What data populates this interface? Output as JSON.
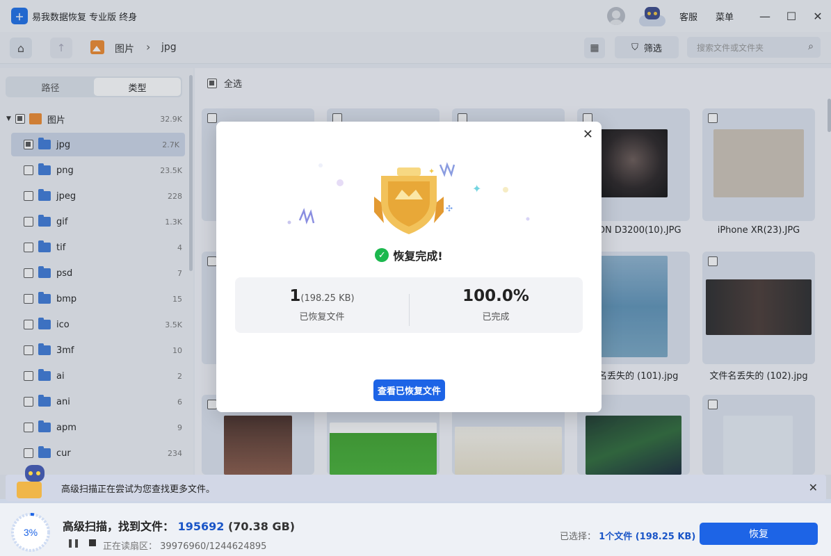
{
  "app": {
    "title": "易我数据恢复 专业版 终身"
  },
  "titlebar": {
    "support_label": "客服",
    "menu_label": "菜单",
    "minimize": "—",
    "maximize": "☐",
    "close": "✕"
  },
  "toolbar": {
    "breadcrumb": [
      "图片",
      "jpg"
    ],
    "filter_label": "筛选",
    "search_placeholder": "搜索文件或文件夹"
  },
  "sidebar": {
    "tabs": [
      {
        "label": "路径",
        "active": false
      },
      {
        "label": "类型",
        "active": true
      }
    ],
    "root": {
      "label": "图片",
      "count": "32.9K"
    },
    "items": [
      {
        "label": "jpg",
        "count": "2.7K",
        "selected": true
      },
      {
        "label": "png",
        "count": "23.5K"
      },
      {
        "label": "jpeg",
        "count": "228"
      },
      {
        "label": "gif",
        "count": "1.3K"
      },
      {
        "label": "tif",
        "count": "4"
      },
      {
        "label": "psd",
        "count": "7"
      },
      {
        "label": "bmp",
        "count": "15"
      },
      {
        "label": "ico",
        "count": "3.5K"
      },
      {
        "label": "3mf",
        "count": "10"
      },
      {
        "label": "ai",
        "count": "2"
      },
      {
        "label": "ani",
        "count": "6"
      },
      {
        "label": "apm",
        "count": "9"
      },
      {
        "label": "cur",
        "count": "234"
      }
    ]
  },
  "main": {
    "select_all_label": "全选",
    "files": [
      {
        "name": "DN D3200(10).JPG"
      },
      {
        "name": "iPhone XR(23).JPG"
      },
      {
        "name": "名丢失的 (101).jpg"
      },
      {
        "name": "文件名丢失的 (102).jpg"
      }
    ]
  },
  "notice": {
    "text": "高级扫描正在尝试为您查找更多文件。"
  },
  "bottom": {
    "scan_prefix": "高级扫描，找到文件：",
    "found_count": "195692",
    "found_size": "(70.38 GB)",
    "progress_label": "3%",
    "progress": 0.03,
    "reading_label": "正在读扇区：",
    "reading_value": "39976960/1244624895",
    "selected_label": "已选择：",
    "selected_value": "1个文件 (198.25 KB)",
    "recover_label": "恢复"
  },
  "modal": {
    "status": "恢复完成!",
    "recovered_count": "1",
    "recovered_size": "(198.25 KB)",
    "recovered_caption": "已恢复文件",
    "percent": "100.0%",
    "percent_caption": "已完成",
    "view_button": "查看已恢复文件"
  },
  "colors": {
    "accent": "#1d64e6",
    "success": "#1cb84e",
    "link": "#1a55c7"
  }
}
